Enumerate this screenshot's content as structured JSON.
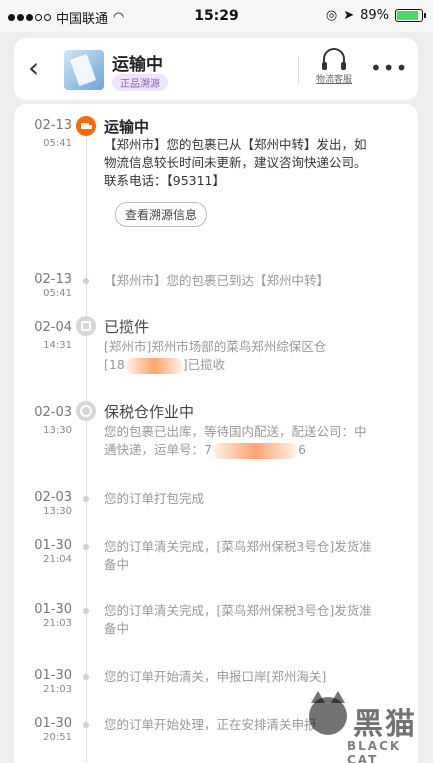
{
  "status_bar": {
    "carrier": "中国联通",
    "time": "15:29",
    "battery": "89%",
    "battery_level": 0.89
  },
  "header": {
    "title": "运输中",
    "badge": "正品溯源",
    "service_label": "物流客服"
  },
  "timeline": [
    {
      "date": "02-13",
      "time": "05:41",
      "title": "运输中",
      "lines": [
        "【郑州市】您的包裹已从【郑州中转】发出，如",
        "物流信息较长时间未更新，建议咨询快递公司。",
        "联系电话：【95311】"
      ],
      "button": "查看溯源信息"
    },
    {
      "date": "02-13",
      "time": "05:41",
      "lines": [
        "【郑州市】您的包裹已到达【郑州中转】"
      ]
    },
    {
      "date": "02-04",
      "time": "14:31",
      "title": "已揽件",
      "lines": [
        "[郑州市]郑州市场部的菜鸟郑州综保区仓",
        "[18",
        "]已揽收"
      ]
    },
    {
      "date": "02-03",
      "time": "13:30",
      "title": "保税仓作业中",
      "lines": [
        "您的包裹已出库，等待国内配送，配送公司：中",
        "通快递，运单号：7",
        "6"
      ]
    },
    {
      "date": "02-03",
      "time": "13:30",
      "lines": [
        "您的订单打包完成"
      ]
    },
    {
      "date": "01-30",
      "time": "21:04",
      "lines": [
        "您的订单清关完成，[菜鸟郑州保税3号仓]发货准",
        "备中"
      ]
    },
    {
      "date": "01-30",
      "time": "21:03",
      "lines": [
        "您的订单清关完成，[菜鸟郑州保税3号仓]发货准",
        "备中"
      ]
    },
    {
      "date": "01-30",
      "time": "21:03",
      "lines": [
        "您的订单开始清关，申报口岸[郑州海关]"
      ]
    },
    {
      "date": "01-30",
      "time": "20:51",
      "lines": [
        "您的订单开始处理，正在安排清关申报"
      ]
    }
  ],
  "watermark": {
    "cn": "黑猫",
    "en": "BLACK CAT"
  }
}
